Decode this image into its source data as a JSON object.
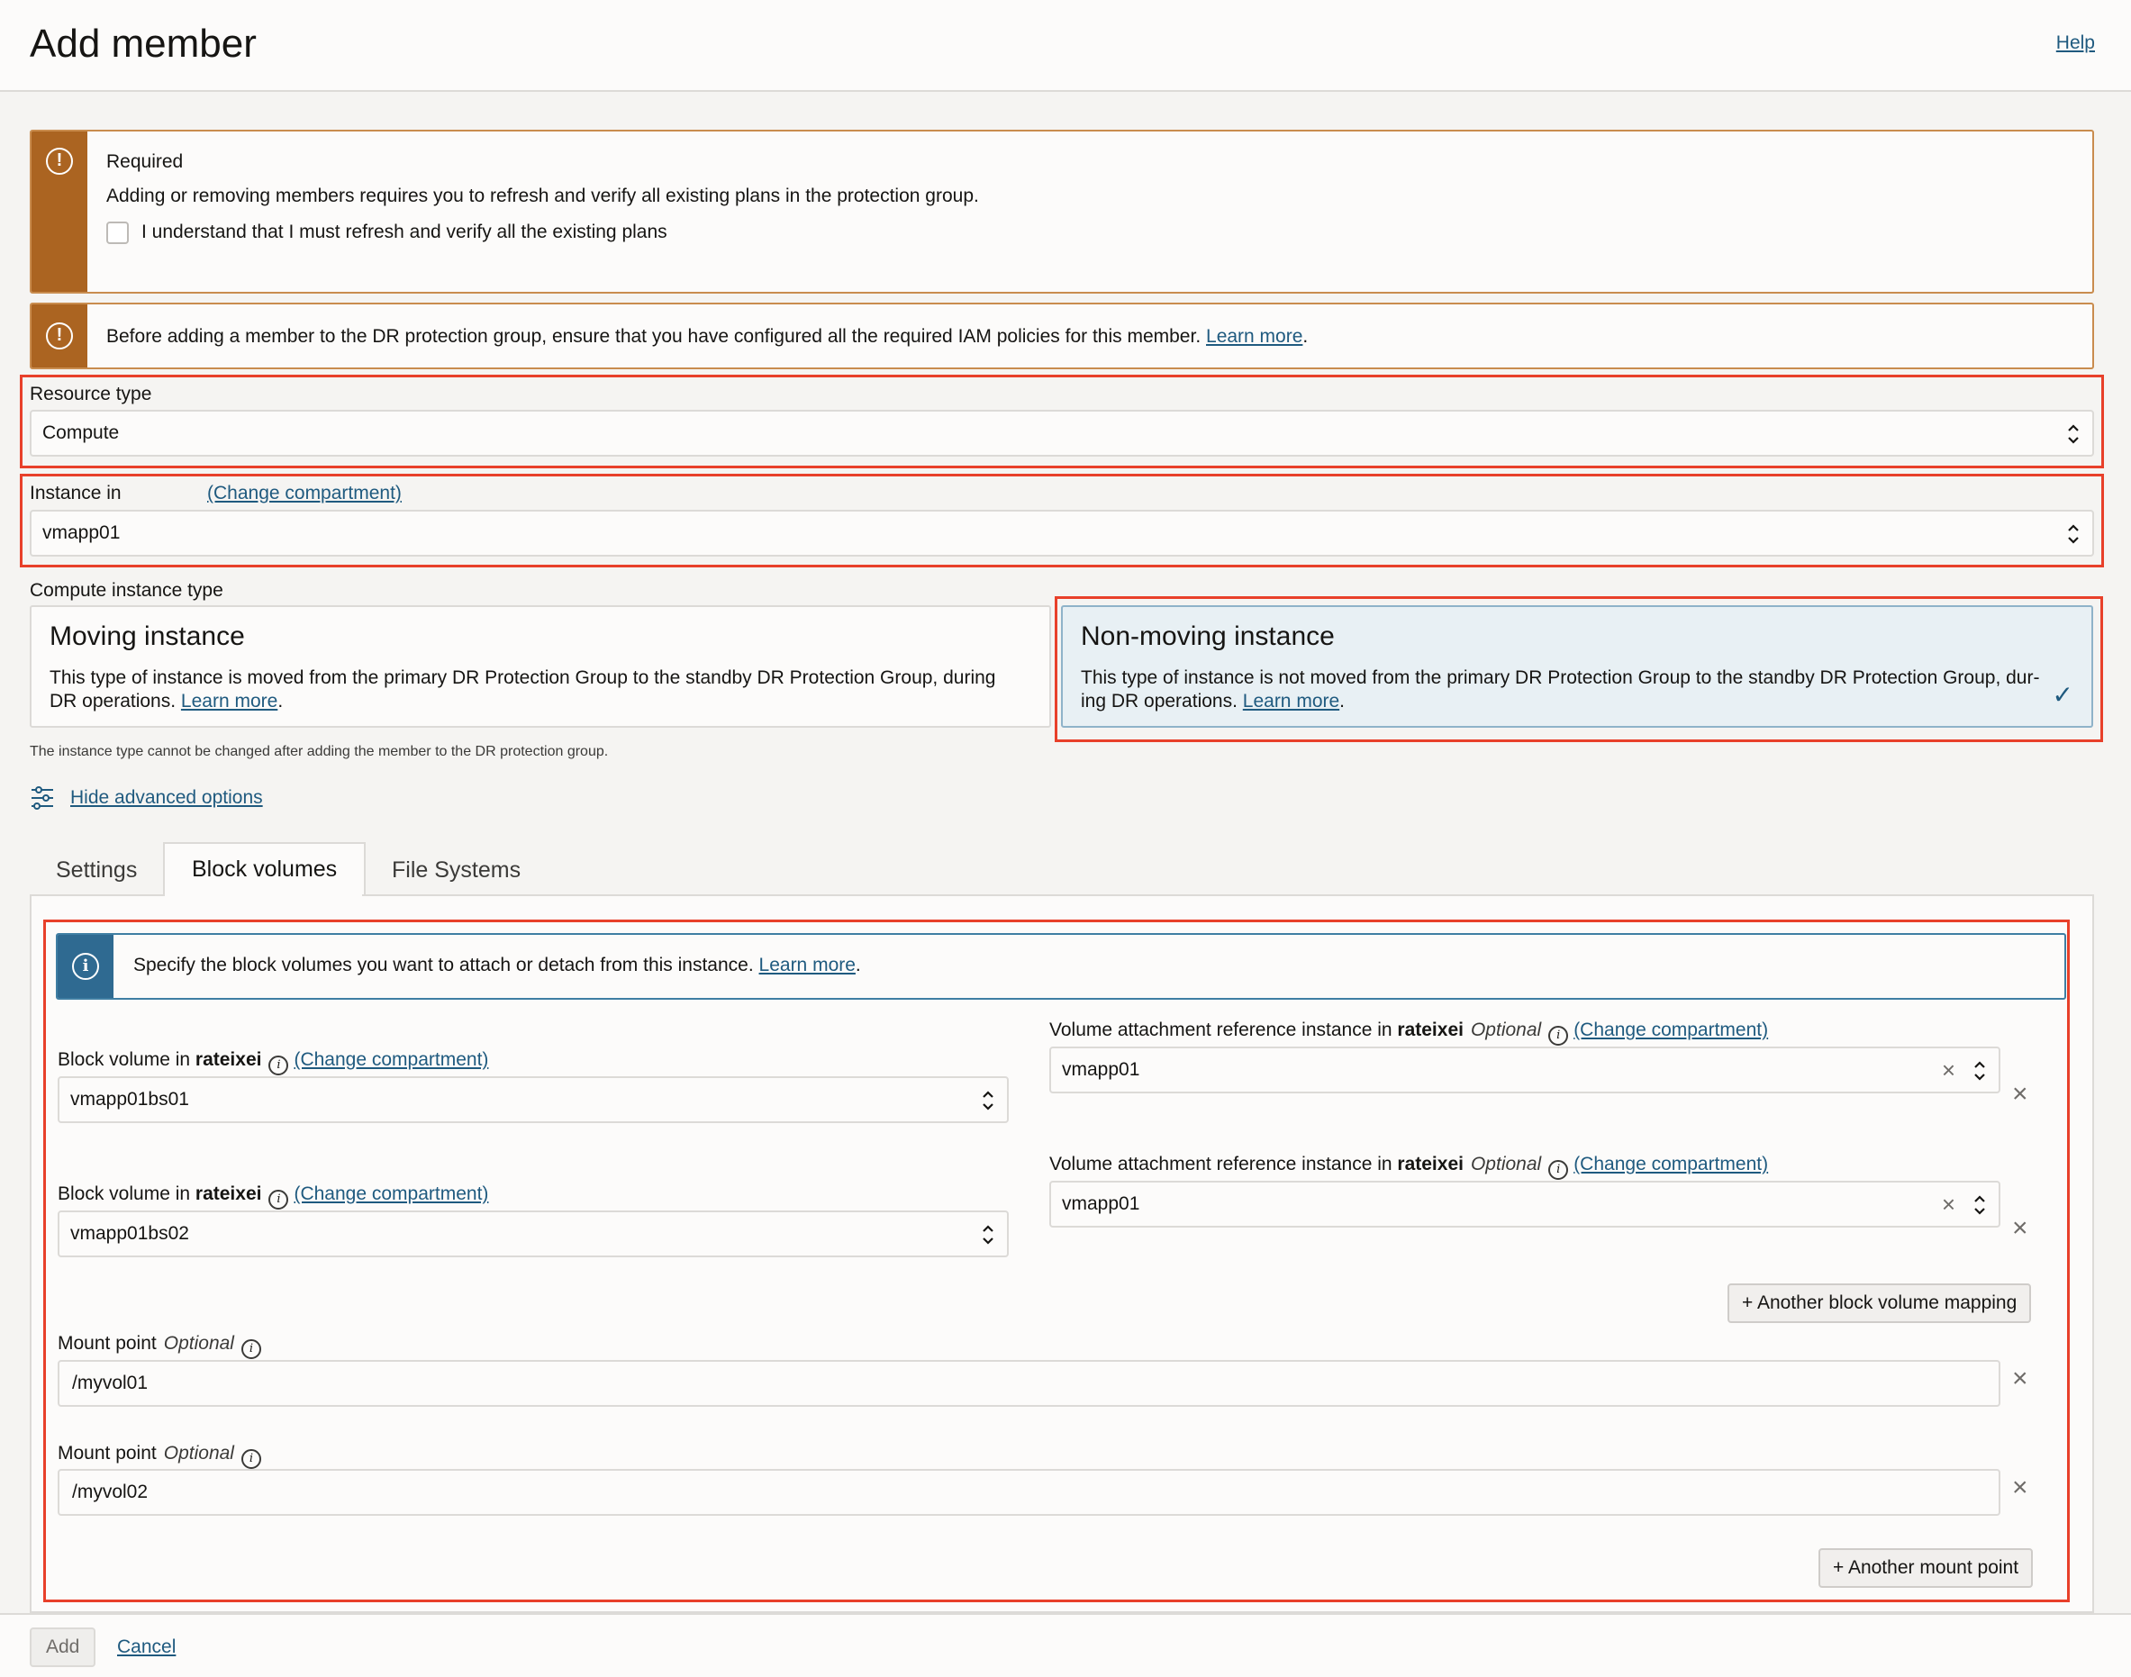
{
  "header": {
    "title": "Add member",
    "help": "Help"
  },
  "alert_required": {
    "title": "Required",
    "message": "Adding or removing members requires you to refresh and verify all existing plans in the protection group.",
    "checkbox_label": "I understand that I must refresh and verify all the existing plans",
    "checkbox_checked": false
  },
  "alert_iam": {
    "message": "Before adding a member to the DR protection group, ensure that you have configured all the required IAM policies for this member.",
    "link": "Learn more",
    "suffix": "."
  },
  "resource_type": {
    "label": "Resource type",
    "value": "Compute"
  },
  "instance": {
    "label": "Instance in",
    "change_link": "(Change compartment)",
    "value": "vmapp01"
  },
  "compute_instance_type": {
    "label": "Compute instance type",
    "moving": {
      "title": "Moving instance",
      "desc": "This type of instance is moved from the primary DR Protection Group to the standby DR Protection Group, during DR operations.",
      "link": "Learn more"
    },
    "non_moving": {
      "title": "Non-moving instance",
      "desc": "This type of instance is not moved from the primary DR Protection Group to the standby DR Protection Group, dur-ing DR operations.",
      "link": "Learn more",
      "selected": true
    },
    "hint": "The instance type cannot be changed after adding the member to the DR protection group."
  },
  "advanced": {
    "label": "Hide advanced options"
  },
  "tabs": [
    {
      "label": "Settings",
      "active": false
    },
    {
      "label": "Block volumes",
      "active": true
    },
    {
      "label": "File Systems",
      "active": false
    }
  ],
  "block_volumes": {
    "info": "Specify the block volumes you want to attach or detach from this instance.",
    "info_link": "Learn more",
    "info_suffix": ".",
    "mappings": [
      {
        "bv_label_prefix": "Block volume in",
        "bv_compartment": "rateixei",
        "bv_change": "(Change compartment)",
        "bv_value": "vmapp01bs01",
        "ref_label_prefix": "Volume attachment reference instance in",
        "ref_compartment": "rateixei",
        "ref_optional": "Optional",
        "ref_change": "(Change compartment)",
        "ref_value": "vmapp01"
      },
      {
        "bv_label_prefix": "Block volume in",
        "bv_compartment": "rateixei",
        "bv_change": "(Change compartment)",
        "bv_value": "vmapp01bs02",
        "ref_label_prefix": "Volume attachment reference instance in",
        "ref_compartment": "rateixei",
        "ref_optional": "Optional",
        "ref_change": "(Change compartment)",
        "ref_value": "vmapp01"
      }
    ],
    "another_mapping": "+ Another block volume mapping",
    "mount_points": [
      {
        "label": "Mount point",
        "optional": "Optional",
        "value": "/myvol01"
      },
      {
        "label": "Mount point",
        "optional": "Optional",
        "value": "/myvol02"
      }
    ],
    "another_mount": "+ Another mount point"
  },
  "footer": {
    "add": "Add",
    "cancel": "Cancel"
  },
  "colors": {
    "warning": "#ab6421",
    "info": "#2f6a91",
    "highlight": "#e8402a",
    "link": "#1f5a7f"
  }
}
